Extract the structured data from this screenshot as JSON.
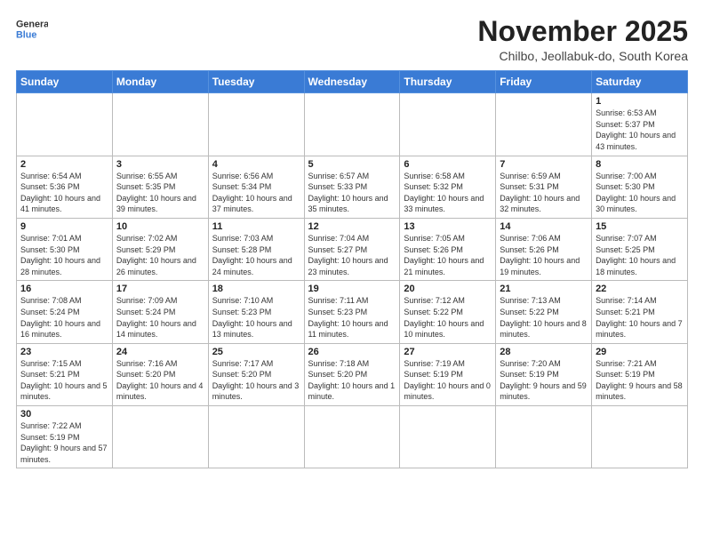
{
  "logo": {
    "line1": "General",
    "line2": "Blue"
  },
  "title": "November 2025",
  "location": "Chilbo, Jeollabuk-do, South Korea",
  "weekdays": [
    "Sunday",
    "Monday",
    "Tuesday",
    "Wednesday",
    "Thursday",
    "Friday",
    "Saturday"
  ],
  "weeks": [
    [
      {
        "day": "",
        "info": ""
      },
      {
        "day": "",
        "info": ""
      },
      {
        "day": "",
        "info": ""
      },
      {
        "day": "",
        "info": ""
      },
      {
        "day": "",
        "info": ""
      },
      {
        "day": "",
        "info": ""
      },
      {
        "day": "1",
        "info": "Sunrise: 6:53 AM\nSunset: 5:37 PM\nDaylight: 10 hours and 43 minutes."
      }
    ],
    [
      {
        "day": "2",
        "info": "Sunrise: 6:54 AM\nSunset: 5:36 PM\nDaylight: 10 hours and 41 minutes."
      },
      {
        "day": "3",
        "info": "Sunrise: 6:55 AM\nSunset: 5:35 PM\nDaylight: 10 hours and 39 minutes."
      },
      {
        "day": "4",
        "info": "Sunrise: 6:56 AM\nSunset: 5:34 PM\nDaylight: 10 hours and 37 minutes."
      },
      {
        "day": "5",
        "info": "Sunrise: 6:57 AM\nSunset: 5:33 PM\nDaylight: 10 hours and 35 minutes."
      },
      {
        "day": "6",
        "info": "Sunrise: 6:58 AM\nSunset: 5:32 PM\nDaylight: 10 hours and 33 minutes."
      },
      {
        "day": "7",
        "info": "Sunrise: 6:59 AM\nSunset: 5:31 PM\nDaylight: 10 hours and 32 minutes."
      },
      {
        "day": "8",
        "info": "Sunrise: 7:00 AM\nSunset: 5:30 PM\nDaylight: 10 hours and 30 minutes."
      }
    ],
    [
      {
        "day": "9",
        "info": "Sunrise: 7:01 AM\nSunset: 5:30 PM\nDaylight: 10 hours and 28 minutes."
      },
      {
        "day": "10",
        "info": "Sunrise: 7:02 AM\nSunset: 5:29 PM\nDaylight: 10 hours and 26 minutes."
      },
      {
        "day": "11",
        "info": "Sunrise: 7:03 AM\nSunset: 5:28 PM\nDaylight: 10 hours and 24 minutes."
      },
      {
        "day": "12",
        "info": "Sunrise: 7:04 AM\nSunset: 5:27 PM\nDaylight: 10 hours and 23 minutes."
      },
      {
        "day": "13",
        "info": "Sunrise: 7:05 AM\nSunset: 5:26 PM\nDaylight: 10 hours and 21 minutes."
      },
      {
        "day": "14",
        "info": "Sunrise: 7:06 AM\nSunset: 5:26 PM\nDaylight: 10 hours and 19 minutes."
      },
      {
        "day": "15",
        "info": "Sunrise: 7:07 AM\nSunset: 5:25 PM\nDaylight: 10 hours and 18 minutes."
      }
    ],
    [
      {
        "day": "16",
        "info": "Sunrise: 7:08 AM\nSunset: 5:24 PM\nDaylight: 10 hours and 16 minutes."
      },
      {
        "day": "17",
        "info": "Sunrise: 7:09 AM\nSunset: 5:24 PM\nDaylight: 10 hours and 14 minutes."
      },
      {
        "day": "18",
        "info": "Sunrise: 7:10 AM\nSunset: 5:23 PM\nDaylight: 10 hours and 13 minutes."
      },
      {
        "day": "19",
        "info": "Sunrise: 7:11 AM\nSunset: 5:23 PM\nDaylight: 10 hours and 11 minutes."
      },
      {
        "day": "20",
        "info": "Sunrise: 7:12 AM\nSunset: 5:22 PM\nDaylight: 10 hours and 10 minutes."
      },
      {
        "day": "21",
        "info": "Sunrise: 7:13 AM\nSunset: 5:22 PM\nDaylight: 10 hours and 8 minutes."
      },
      {
        "day": "22",
        "info": "Sunrise: 7:14 AM\nSunset: 5:21 PM\nDaylight: 10 hours and 7 minutes."
      }
    ],
    [
      {
        "day": "23",
        "info": "Sunrise: 7:15 AM\nSunset: 5:21 PM\nDaylight: 10 hours and 5 minutes."
      },
      {
        "day": "24",
        "info": "Sunrise: 7:16 AM\nSunset: 5:20 PM\nDaylight: 10 hours and 4 minutes."
      },
      {
        "day": "25",
        "info": "Sunrise: 7:17 AM\nSunset: 5:20 PM\nDaylight: 10 hours and 3 minutes."
      },
      {
        "day": "26",
        "info": "Sunrise: 7:18 AM\nSunset: 5:20 PM\nDaylight: 10 hours and 1 minute."
      },
      {
        "day": "27",
        "info": "Sunrise: 7:19 AM\nSunset: 5:19 PM\nDaylight: 10 hours and 0 minutes."
      },
      {
        "day": "28",
        "info": "Sunrise: 7:20 AM\nSunset: 5:19 PM\nDaylight: 9 hours and 59 minutes."
      },
      {
        "day": "29",
        "info": "Sunrise: 7:21 AM\nSunset: 5:19 PM\nDaylight: 9 hours and 58 minutes."
      }
    ],
    [
      {
        "day": "30",
        "info": "Sunrise: 7:22 AM\nSunset: 5:19 PM\nDaylight: 9 hours and 57 minutes."
      },
      {
        "day": "",
        "info": ""
      },
      {
        "day": "",
        "info": ""
      },
      {
        "day": "",
        "info": ""
      },
      {
        "day": "",
        "info": ""
      },
      {
        "day": "",
        "info": ""
      },
      {
        "day": "",
        "info": ""
      }
    ]
  ]
}
